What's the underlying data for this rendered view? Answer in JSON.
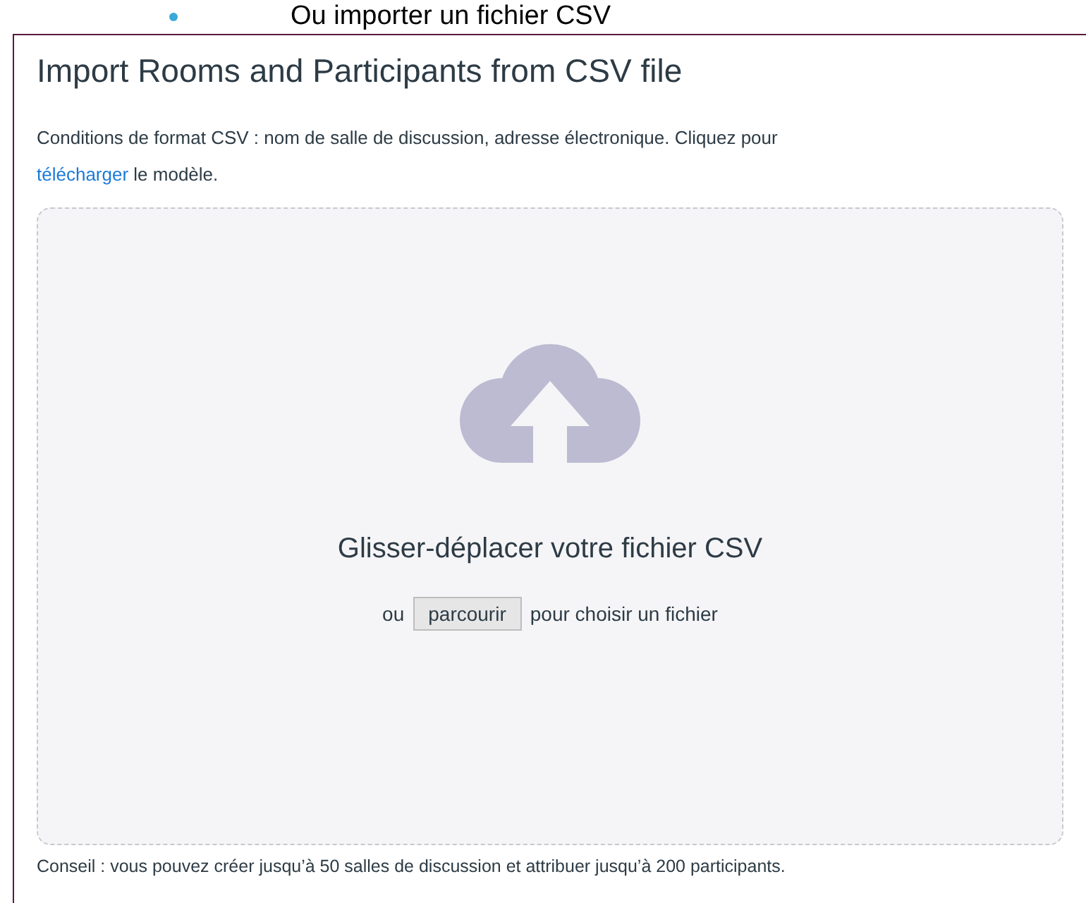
{
  "bullet": {
    "text": "Ou importer un fichier CSV"
  },
  "dialog": {
    "title": "Import Rooms and Participants from CSV file",
    "instructions": "Conditions de format CSV : nom de salle de discussion, adresse électronique. Cliquez pour",
    "template_link": "télécharger",
    "instructions_end": "le modèle.",
    "dropzone": {
      "heading": "Glisser-déplacer votre fichier CSV",
      "prefix": "ou",
      "browse_button": "parcourir",
      "suffix": "pour choisir un fichier"
    },
    "tip": "Conseil : vous pouvez créer jusqu’à 50 salles de discussion et attribuer jusqu’à 200 participants."
  }
}
